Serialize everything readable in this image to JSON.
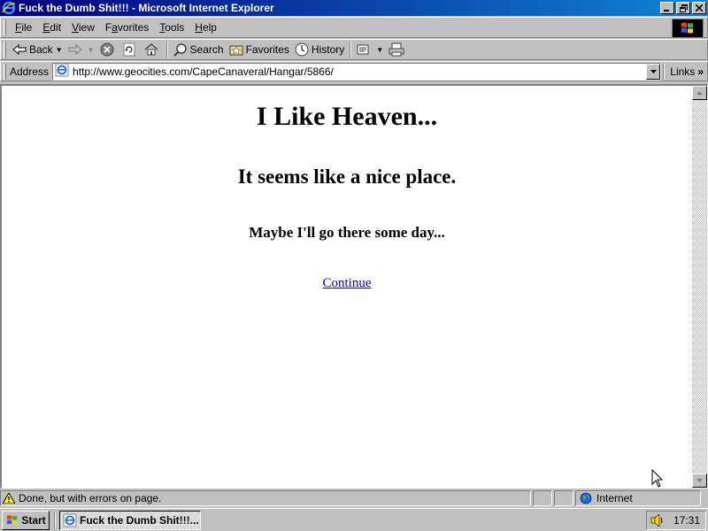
{
  "window": {
    "title": "Fuck the Dumb Shit!!! - Microsoft Internet Explorer"
  },
  "menu": {
    "items": [
      {
        "label": "File",
        "key": "F"
      },
      {
        "label": "Edit",
        "key": "E"
      },
      {
        "label": "View",
        "key": "V"
      },
      {
        "label": "Favorites",
        "key": "a"
      },
      {
        "label": "Tools",
        "key": "T"
      },
      {
        "label": "Help",
        "key": "H"
      }
    ]
  },
  "toolbar": {
    "back_label": "Back",
    "search_label": "Search",
    "favorites_label": "Favorites",
    "history_label": "History"
  },
  "address": {
    "label": "Address",
    "url": "http://www.geocities.com/CapeCanaveral/Hangar/5866/",
    "links_label": "Links"
  },
  "page": {
    "heading1": "I Like Heaven...",
    "heading2": "It seems like a nice place.",
    "heading3": "Maybe I'll go there some day...",
    "link_text": "Continue"
  },
  "status": {
    "message": "Done, but with errors on page.",
    "zone": "Internet"
  },
  "taskbar": {
    "start_label": "Start",
    "task_label": "Fuck the Dumb Shit!!!...",
    "clock": "17:31"
  },
  "colors": {
    "titlebar_start": "#000080",
    "titlebar_end": "#1084d0",
    "link": "#0000ee",
    "chrome": "#c0c0c0"
  }
}
